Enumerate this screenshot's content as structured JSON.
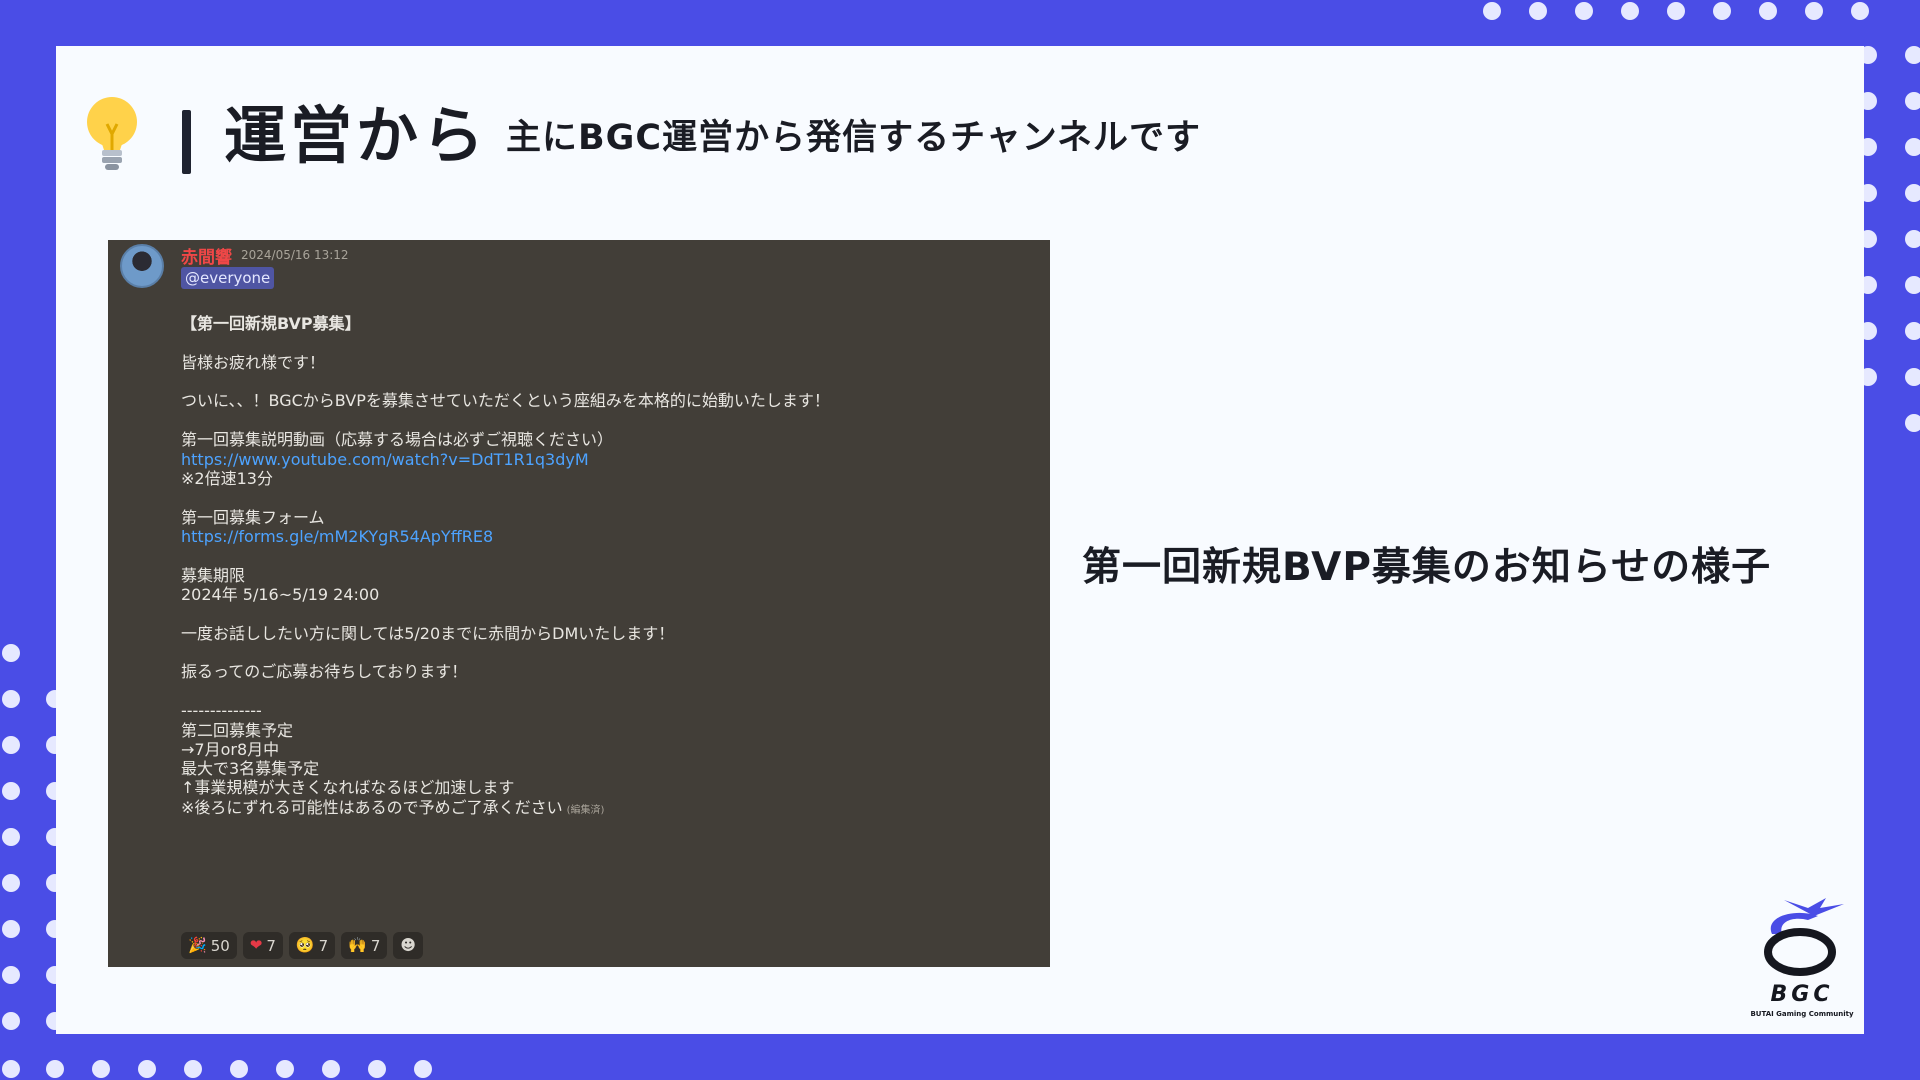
{
  "colors": {
    "background": "#4a4de6",
    "card": "#f8fbff",
    "message_bg": "#423e38",
    "author": "#f04747",
    "link": "#4da3ff",
    "mention_bg": "#4f55a3"
  },
  "header": {
    "icon": "lightbulb-icon",
    "title": "運営から",
    "subtitle": "主にBGC運営から発信するチャンネルです"
  },
  "message": {
    "author": "赤間響",
    "timestamp": "2024/05/16 13:12",
    "mention": "@everyone",
    "lines": [
      "【第一回新規BVP募集】",
      "皆様お疲れ様です！",
      "ついに、、！BGCからBVPを募集させていただくという座組みを本格的に始動いたします！",
      "第一回募集説明動画（応募する場合は必ずご視聴ください）",
      "https://www.youtube.com/watch?v=DdT1R1q3dyM",
      "※2倍速13分",
      "第一回募集フォーム",
      "https://forms.gle/mM2KYgR54ApYffRE8",
      "募集期限",
      "2024年 5/16~5/19 24:00",
      "一度お話ししたい方に関しては5/20までに赤間からDMいたします！",
      "振るってのご応募お待ちしております！",
      "--------------",
      "第二回募集予定",
      "→7月or8月中",
      "最大で3名募集予定",
      "↑事業規模が大きくなればなるほど加速します",
      "※後ろにずれる可能性はあるので予めご了承ください"
    ],
    "edited_label": "(編集済)",
    "reactions": [
      {
        "emoji": "🎉",
        "count": "50"
      },
      {
        "emoji": "❤",
        "count": "7"
      },
      {
        "emoji": "🥺",
        "count": "7"
      },
      {
        "emoji": "🙌",
        "count": "7"
      },
      {
        "emoji": "☻",
        "count": ""
      }
    ]
  },
  "caption": "第一回新規BVP募集のお知らせの様子",
  "logo": {
    "text": "BGC",
    "subtext": "BUTAI Gaming Community"
  }
}
